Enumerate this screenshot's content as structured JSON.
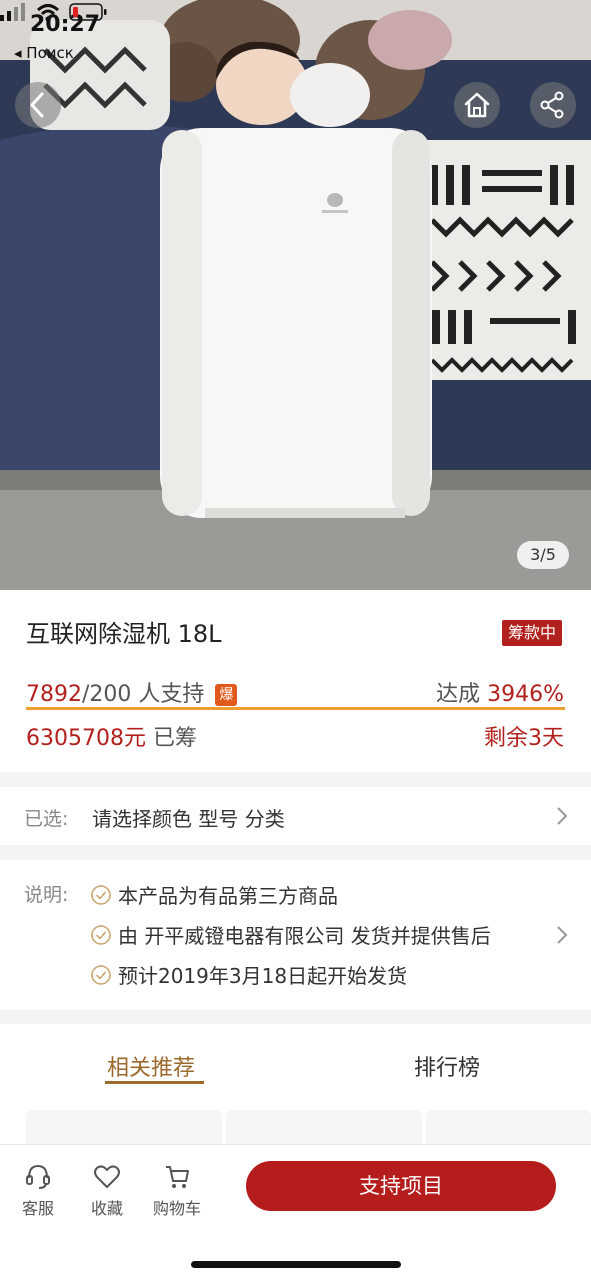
{
  "status_bar": {
    "time": "20:27",
    "back_app": "◂ Поиск"
  },
  "hero": {
    "image_counter": "3/5",
    "icons": [
      "back-arrow-icon",
      "home-icon",
      "share-icon"
    ]
  },
  "product": {
    "title": "互联网除湿机 18L",
    "status_badge": "筹款中",
    "supporters_count": "7892",
    "supporters_target": "/200 人支持",
    "hot_badge": "爆",
    "reached_label": "达成",
    "reached_percent": "3946%",
    "progress_fraction": 1.0,
    "raised_amount": "6305708元",
    "raised_label": "已筹",
    "remaining": "剩余3天"
  },
  "selection": {
    "label": "已选:",
    "value": "请选择颜色 型号 分类"
  },
  "description": {
    "label": "说明:",
    "items": [
      "本产品为有品第三方商品",
      "由 开平威镫电器有限公司 发货并提供售后",
      "预计2019年3月18日起开始发货"
    ]
  },
  "tabs": {
    "items": [
      "相关推荐",
      "排行榜"
    ],
    "active": "相关推荐"
  },
  "bottom_bar": {
    "service": "客服",
    "favorite": "收藏",
    "cart": "购物车",
    "cta": "支持项目"
  },
  "colors": {
    "accent_red": "#b3211e",
    "progress_orange": "#f0a032",
    "tab_gold": "#9c6a2e",
    "cta_red": "#b51c1c"
  }
}
